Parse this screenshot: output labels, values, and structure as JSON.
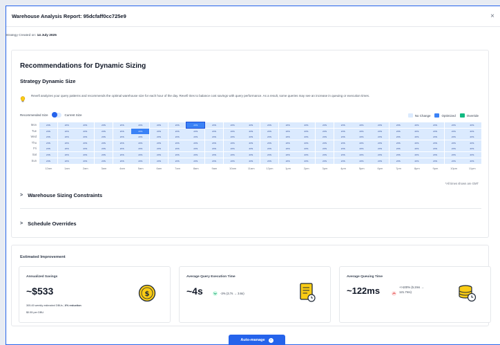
{
  "header": {
    "title": "Warehouse Analysis Report: 95dcfaff0cc725e9"
  },
  "created": {
    "label": "Strategy Created on:",
    "date": "14 July 2025"
  },
  "recommendations": {
    "title": "Recommendations for Dynamic Sizing",
    "subtitle": "Strategy Dynamic Size",
    "description": "Revefi analyzes your query patterns and recommends the optimal warehouse size for each hour of the day. Revefi tries to balance cost savings with query performance. As a result, some queries may see an increase in queuing or execution times.",
    "toggle": {
      "left_label": "Recommended Size",
      "right_label": "Current Size"
    },
    "legend": [
      {
        "label": "No Change",
        "color": "#dbeafe"
      },
      {
        "label": "Optimized",
        "color": "#3b82f6"
      },
      {
        "label": "Override",
        "color": "#10b981"
      }
    ],
    "grid": {
      "days": [
        "Mon",
        "Tue",
        "Wed",
        "Thu",
        "Fri",
        "Sat",
        "Sun"
      ],
      "hours": [
        "12am",
        "1am",
        "2am",
        "3am",
        "4am",
        "5am",
        "6am",
        "7am",
        "8am",
        "9am",
        "10am",
        "11am",
        "12pm",
        "1pm",
        "2pm",
        "3pm",
        "4pm",
        "5pm",
        "6pm",
        "7pm",
        "8pm",
        "9pm",
        "10pm",
        "11pm"
      ],
      "cell_value": "2XS",
      "optimized_cells": [
        [
          0,
          8
        ],
        [
          1,
          5
        ]
      ],
      "selected_cell": [
        0,
        8
      ]
    },
    "timezone_note": "*All times shown are GMT",
    "sections": [
      {
        "label": "Warehouse Sizing Constraints"
      },
      {
        "label": "Schedule Overrides"
      }
    ]
  },
  "improvement": {
    "title": "Estimated Improvement",
    "savings": {
      "label": "Annualized Savings",
      "value": "~$533",
      "detail_prefix": "305.45 weekly estimated DBUs",
      "detail_reduction": "6% reduction",
      "detail_rate": "$0.55 per DBU"
    },
    "execution": {
      "label": "Average Query Execution Time",
      "value": "~4s",
      "delta": "-3% (3.7s → 3.6s)"
    },
    "queuing": {
      "label": "Average Queuing Time",
      "value": "~122ms",
      "delta_line1": "+>100% (5.2ms →",
      "delta_line2": "121.7ms)"
    }
  },
  "footer": {
    "button_label": "Auto-manage"
  },
  "colors": {
    "accent": "#2563eb",
    "icon_yellow": "#facc15"
  }
}
